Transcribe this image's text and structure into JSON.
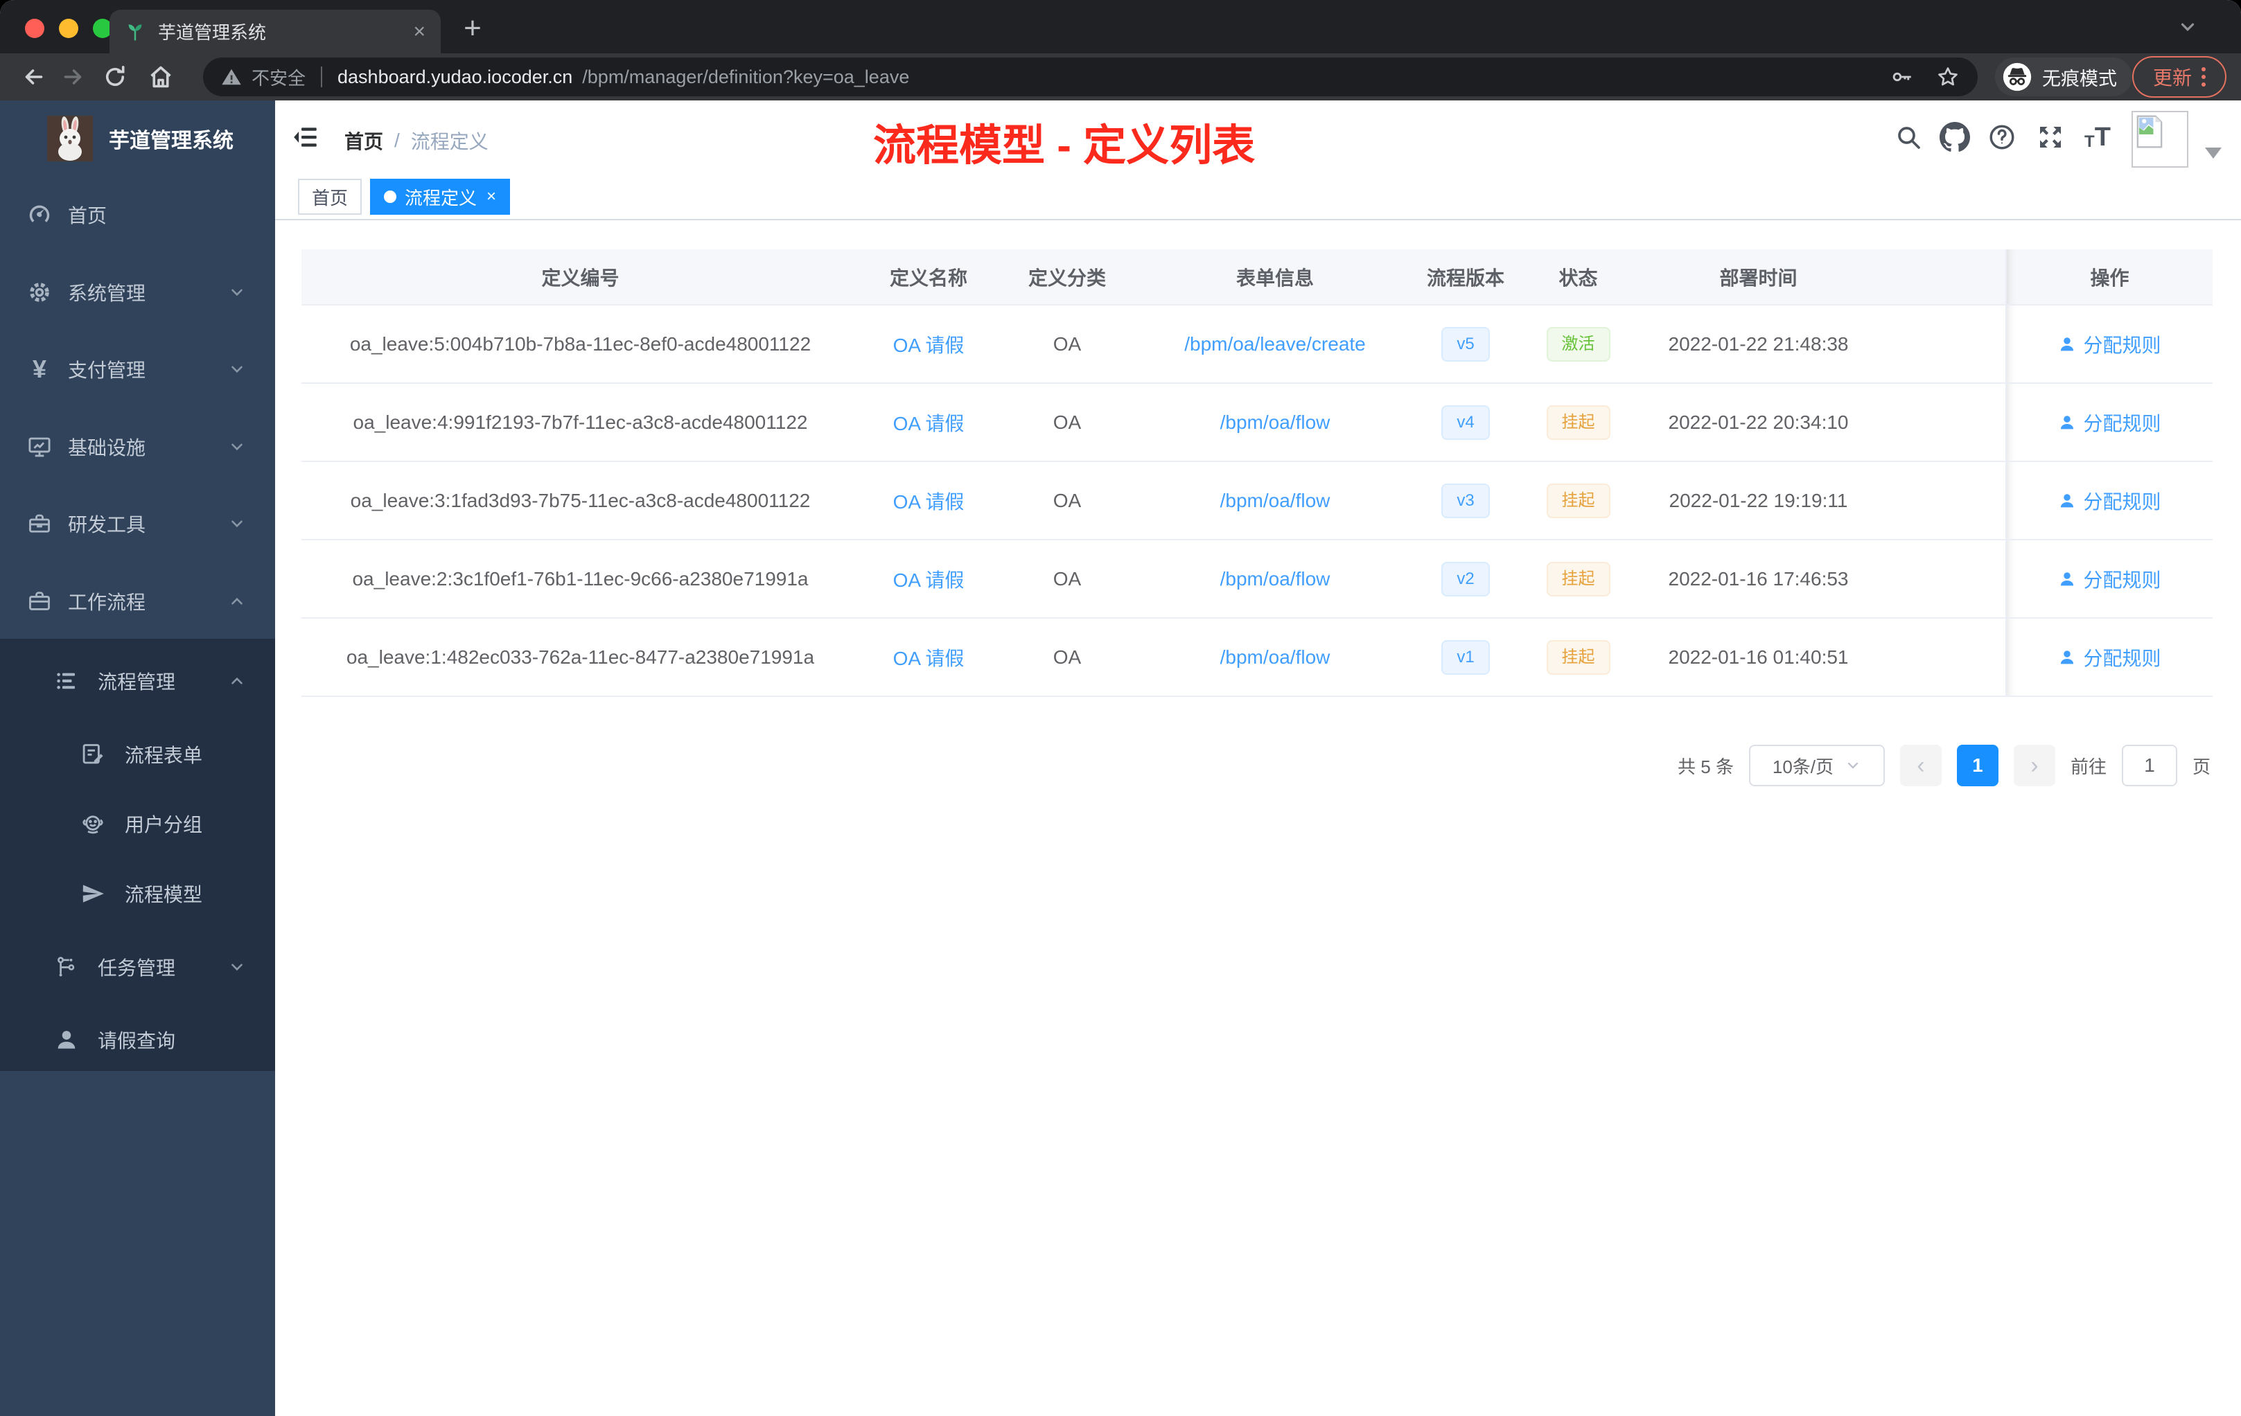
{
  "browser": {
    "tab": {
      "title": "芋道管理系统"
    },
    "address": {
      "security_label": "不安全",
      "domain": "dashboard.yudao.iocoder.cn",
      "path": "/bpm/manager/definition?key=oa_leave"
    },
    "incognito_label": "无痕模式",
    "update_label": "更新"
  },
  "sidebar": {
    "app_title": "芋道管理系统",
    "items": [
      {
        "label": "首页",
        "icon": "dashboard-icon"
      },
      {
        "label": "系统管理",
        "icon": "gear-icon"
      },
      {
        "label": "支付管理",
        "icon": "yen-icon"
      },
      {
        "label": "基础设施",
        "icon": "monitor-icon"
      },
      {
        "label": "研发工具",
        "icon": "toolbox-icon"
      },
      {
        "label": "工作流程",
        "icon": "briefcase-icon"
      },
      {
        "label": "流程管理",
        "icon": "tree-list-icon"
      },
      {
        "label": "流程表单",
        "icon": "form-edit-icon"
      },
      {
        "label": "用户分组",
        "icon": "user-group-icon"
      },
      {
        "label": "流程模型",
        "icon": "paper-plane-icon"
      },
      {
        "label": "任务管理",
        "icon": "task-flow-icon"
      },
      {
        "label": "请假查询",
        "icon": "person-icon"
      }
    ]
  },
  "header": {
    "breadcrumb": [
      "首页",
      "流程定义"
    ],
    "breadcrumb_separator": "/",
    "annotation": "流程模型 - 定义列表"
  },
  "tags": [
    {
      "label": "首页",
      "active": false
    },
    {
      "label": "流程定义",
      "active": true
    }
  ],
  "table": {
    "columns": [
      "定义编号",
      "定义名称",
      "定义分类",
      "表单信息",
      "流程版本",
      "状态",
      "部署时间",
      "操作"
    ],
    "rows": [
      {
        "id": "oa_leave:5:004b710b-7b8a-11ec-8ef0-acde48001122",
        "name": "OA 请假",
        "category": "OA",
        "form": "/bpm/oa/leave/create",
        "version": "v5",
        "status": "激活",
        "status_type": "success",
        "deployed_at": "2022-01-22 21:48:38",
        "action": "分配规则"
      },
      {
        "id": "oa_leave:4:991f2193-7b7f-11ec-a3c8-acde48001122",
        "name": "OA 请假",
        "category": "OA",
        "form": "/bpm/oa/flow",
        "version": "v4",
        "status": "挂起",
        "status_type": "warning",
        "deployed_at": "2022-01-22 20:34:10",
        "action": "分配规则"
      },
      {
        "id": "oa_leave:3:1fad3d93-7b75-11ec-a3c8-acde48001122",
        "name": "OA 请假",
        "category": "OA",
        "form": "/bpm/oa/flow",
        "version": "v3",
        "status": "挂起",
        "status_type": "warning",
        "deployed_at": "2022-01-22 19:19:11",
        "action": "分配规则"
      },
      {
        "id": "oa_leave:2:3c1f0ef1-76b1-11ec-9c66-a2380e71991a",
        "name": "OA 请假",
        "category": "OA",
        "form": "/bpm/oa/flow",
        "version": "v2",
        "status": "挂起",
        "status_type": "warning",
        "deployed_at": "2022-01-16 17:46:53",
        "action": "分配规则"
      },
      {
        "id": "oa_leave:1:482ec033-762a-11ec-8477-a2380e71991a",
        "name": "OA 请假",
        "category": "OA",
        "form": "/bpm/oa/flow",
        "version": "v1",
        "status": "挂起",
        "status_type": "warning",
        "deployed_at": "2022-01-16 01:40:51",
        "action": "分配规则"
      }
    ]
  },
  "pagination": {
    "total": "共 5 条",
    "page_size": "10条/页",
    "prev": "‹",
    "page": "1",
    "next": "›",
    "goto_label": "前往",
    "goto_value": "1",
    "unit": "页"
  },
  "colors": {
    "link_accent": "#409eff",
    "active_tag": "#1890ff",
    "success": "#67c23a",
    "warning": "#e6a23c",
    "annotation_red": "#fb2a1d",
    "sidebar_bg": "#30435a",
    "submenu_bg": "#233044"
  }
}
